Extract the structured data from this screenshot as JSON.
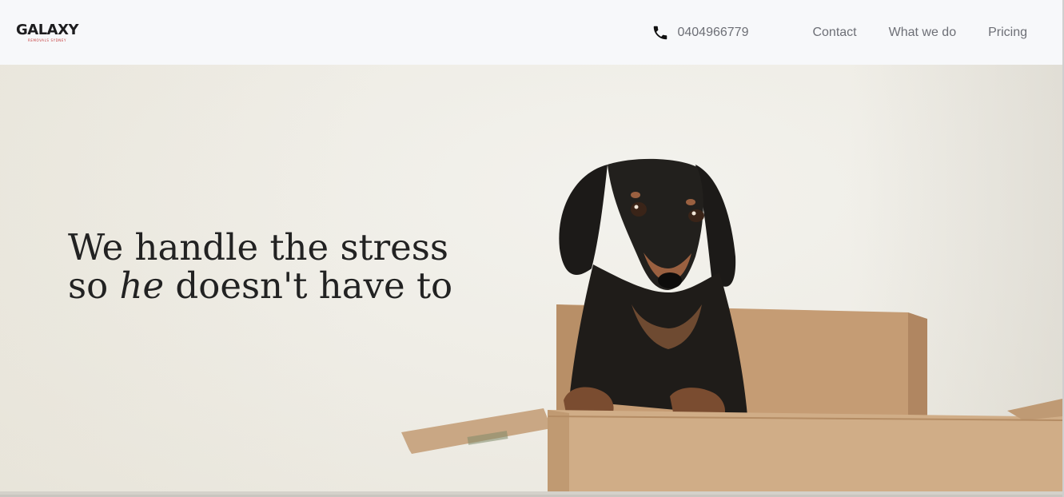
{
  "brand": {
    "name": "GALAXY",
    "tagline": "REMOVALS SYDNEY",
    "accent_color": "#c43a3a"
  },
  "header": {
    "phone_icon": "phone-icon",
    "phone_number": "0404966779",
    "nav": [
      {
        "label": "Contact"
      },
      {
        "label": "What we do"
      },
      {
        "label": "Pricing"
      }
    ]
  },
  "hero": {
    "line1": "We handle the stress",
    "line2_prefix": "so ",
    "line2_emphasis": "he",
    "line2_suffix": " doesn't have to",
    "image": "dachshund-in-cardboard-box"
  }
}
